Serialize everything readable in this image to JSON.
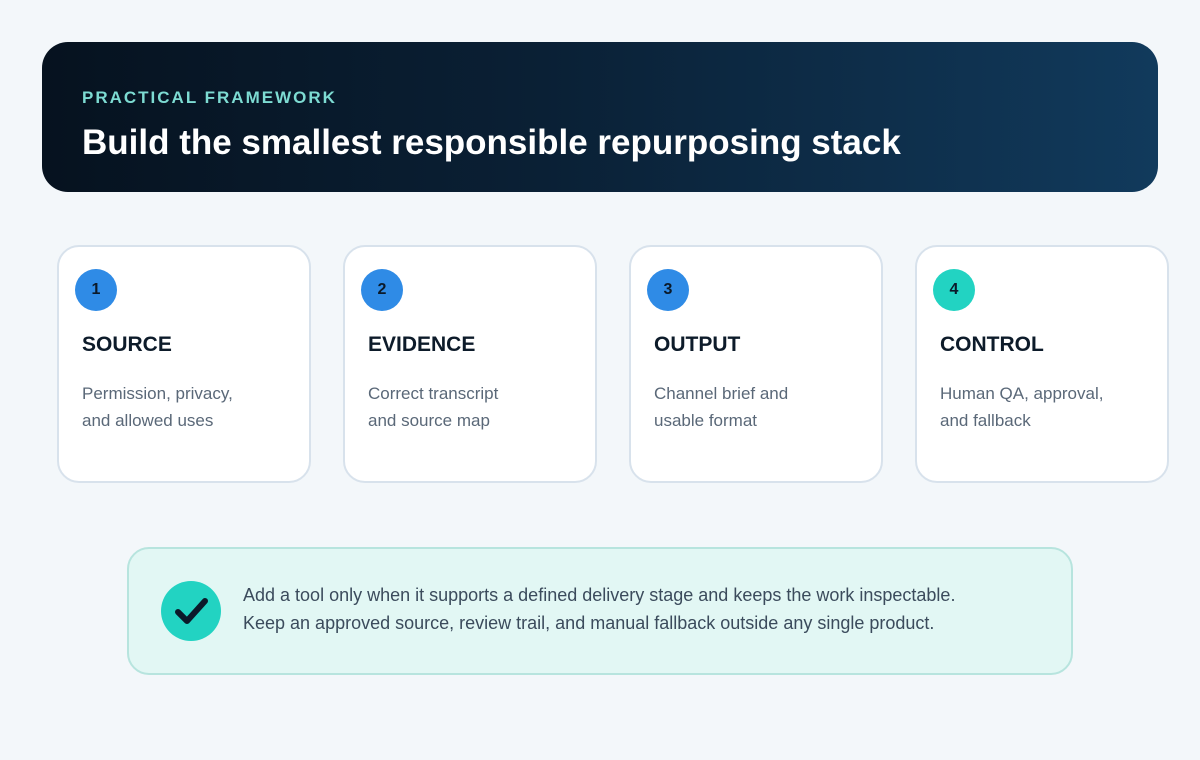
{
  "header": {
    "eyebrow": "PRACTICAL FRAMEWORK",
    "title": "Build the smallest responsible repurposing stack"
  },
  "steps": [
    {
      "number": "1",
      "title": "SOURCE",
      "desc_line1": "Permission, privacy,",
      "desc_line2": "and allowed uses",
      "badge_color": "#2f8be6"
    },
    {
      "number": "2",
      "title": "EVIDENCE",
      "desc_line1": "Correct transcript",
      "desc_line2": "and source map",
      "badge_color": "#2f8be6"
    },
    {
      "number": "3",
      "title": "OUTPUT",
      "desc_line1": "Channel brief and",
      "desc_line2": "usable format",
      "badge_color": "#2f8be6"
    },
    {
      "number": "4",
      "title": "CONTROL",
      "desc_line1": "Human QA, approval,",
      "desc_line2": "and fallback",
      "badge_color": "#22d3c2"
    }
  ],
  "note": {
    "icon": "check-icon",
    "line1": "Add a tool only when it supports a defined delivery stage and keeps the work inspectable.",
    "line2": "Keep an approved source, review trail, and manual fallback outside any single product."
  },
  "colors": {
    "accent_blue": "#2f8be6",
    "accent_teal": "#22d3c2",
    "header_dark": "#06121f"
  }
}
